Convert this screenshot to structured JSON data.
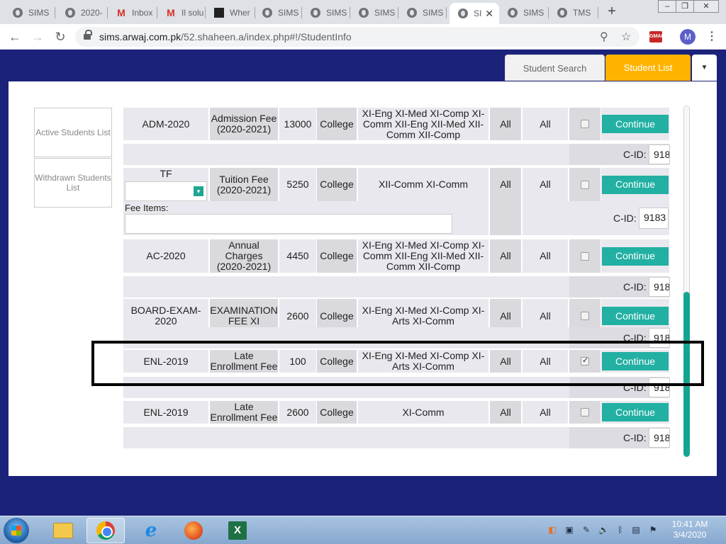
{
  "browser": {
    "tabs": [
      {
        "label": "SIMS",
        "icon": "globe"
      },
      {
        "label": "2020-",
        "icon": "globe"
      },
      {
        "label": "Inbox",
        "icon": "gmail"
      },
      {
        "label": "Il solu",
        "icon": "gmail"
      },
      {
        "label": "Wher",
        "icon": "wiki"
      },
      {
        "label": "SIMS",
        "icon": "globe"
      },
      {
        "label": "SIMS",
        "icon": "globe"
      },
      {
        "label": "SIMS",
        "icon": "globe"
      },
      {
        "label": "SIMS",
        "icon": "globe"
      },
      {
        "label": "SI",
        "icon": "globe",
        "active": true
      },
      {
        "label": "SIMS",
        "icon": "globe"
      },
      {
        "label": "TMS",
        "icon": "globe"
      }
    ],
    "url_host": "sims.arwaj.com.pk",
    "url_path": "/52.shaheen.a/index.php#!/StudentInfo",
    "profile_initial": "M",
    "extension_label": "GMAIL"
  },
  "app": {
    "tabs": {
      "student_search": "Student Search",
      "student_list": "Student List"
    },
    "sidebar": {
      "active_students": "Active Students List",
      "withdrawn_students": "Withdrawn Students List"
    },
    "fee_rows": [
      {
        "code": "ADM-2020",
        "name": "Admission Fee (2020-2021)",
        "amount": "13000",
        "type": "College",
        "classes": "XI-Eng XI-Med XI-Comp XI-Comm XII-Eng XII-Med XII-Comm XII-Comp",
        "col1": "All",
        "col2": "All",
        "checked": false,
        "button": "Continue",
        "cid_label": "C-ID:",
        "cid_value": "918"
      },
      {
        "code": "TF",
        "name": "Tuition Fee (2020-2021)",
        "amount": "5250",
        "type": "College",
        "classes": "XII-Comm XI-Comm",
        "col1": "All",
        "col2": "All",
        "checked": false,
        "button": "Continue",
        "cid_label": "C-ID:",
        "cid_value": "9183",
        "fee_items_label": "Fee Items:"
      },
      {
        "code": "AC-2020",
        "name": "Annual Charges (2020-2021)",
        "amount": "4450",
        "type": "College",
        "classes": "XI-Eng XI-Med XI-Comp XI-Comm XII-Eng XII-Med XII-Comm XII-Comp",
        "col1": "All",
        "col2": "All",
        "checked": false,
        "button": "Continue",
        "cid_label": "C-ID:",
        "cid_value": "918"
      },
      {
        "code": "BOARD-EXAM-2020",
        "name": "EXAMINATION FEE XI",
        "amount": "2600",
        "type": "College",
        "classes": "XI-Eng XI-Med XI-Comp XI-Arts XI-Comm",
        "col1": "All",
        "col2": "All",
        "checked": false,
        "button": "Continue",
        "cid_label": "C-ID:",
        "cid_value": "918"
      },
      {
        "code": "ENL-2019",
        "name": "Late Enrollment Fee",
        "amount": "100",
        "type": "College",
        "classes": "XI-Eng XI-Med XI-Comp XI-Arts XI-Comm",
        "col1": "All",
        "col2": "All",
        "checked": true,
        "button": "Continue",
        "cid_label": "C-ID:",
        "cid_value": "918"
      },
      {
        "code": "ENL-2019",
        "name": "Late Enrollment Fee",
        "amount": "2600",
        "type": "College",
        "classes": "XI-Comm",
        "col1": "All",
        "col2": "All",
        "checked": false,
        "button": "Continue",
        "cid_label": "C-ID:",
        "cid_value": "918"
      }
    ]
  },
  "taskbar": {
    "time": "10:41 AM",
    "date": "3/4/2020"
  },
  "colors": {
    "app_background": "#1b227a",
    "accent_orange": "#ffb300",
    "button_teal": "#22b0a3"
  }
}
